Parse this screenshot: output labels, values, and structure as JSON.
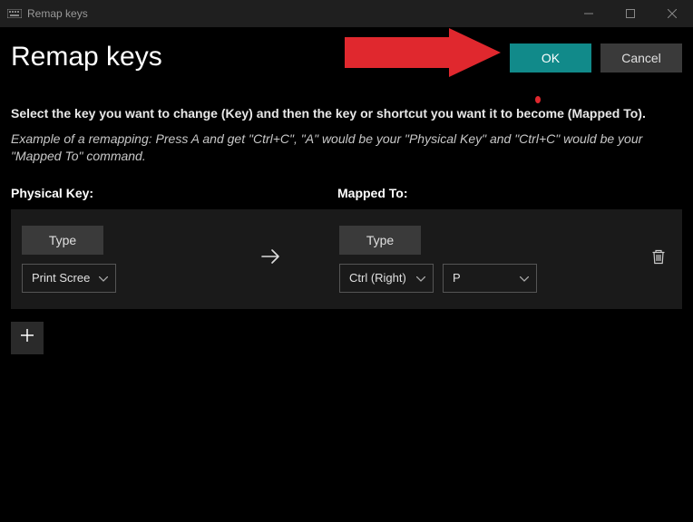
{
  "titlebar": {
    "title": "Remap keys"
  },
  "header": {
    "page_title": "Remap keys",
    "ok_label": "OK",
    "cancel_label": "Cancel"
  },
  "instructions": {
    "main": "Select the key you want to change (Key) and then the key or shortcut you want it to become (Mapped To).",
    "example": "Example of a remapping: Press A and get \"Ctrl+C\", \"A\" would be your \"Physical Key\" and \"Ctrl+C\" would be your \"Mapped To\" command."
  },
  "columns": {
    "physical": "Physical Key:",
    "mapped": "Mapped To:"
  },
  "row": {
    "type_label": "Type",
    "physical_select": "Print Scree",
    "mapped_select_1": "Ctrl (Right)",
    "mapped_select_2": "P"
  }
}
